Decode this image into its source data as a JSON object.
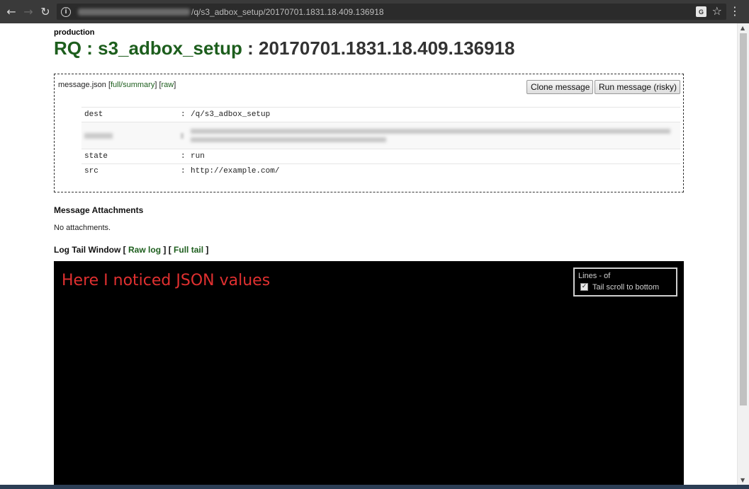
{
  "browser": {
    "url_path": "/q/s3_adbox_setup/20170701.1831.18.409.136918",
    "translate_icon_label": "G",
    "back_glyph": "←",
    "forward_glyph": "→",
    "reload_glyph": "↻",
    "info_glyph": "i",
    "star_glyph": "☆",
    "menu_glyph": "⋮"
  },
  "header": {
    "environment": "production",
    "title_prefix": "RQ",
    "title_sep1": ":",
    "queue_name": "s3_adbox_setup",
    "title_sep2": ":",
    "message_id": "20170701.1831.18.409.136918"
  },
  "message": {
    "filename": "message.json",
    "link_open": "[",
    "full_summary_label": "full/summary",
    "link_mid": "] [",
    "raw_label": "raw",
    "link_close": "]",
    "clone_button": "Clone message",
    "run_button": "Run message (risky)",
    "fields": [
      {
        "key": "dest",
        "sep": ":",
        "value": "/q/s3_adbox_setup"
      },
      {
        "key": "state",
        "sep": ":",
        "value": "run"
      },
      {
        "key": "src",
        "sep": ":",
        "value": "http://example.com/"
      }
    ]
  },
  "attachments": {
    "heading": "Message Attachments",
    "text": "No attachments."
  },
  "log": {
    "heading": "Log Tail Window",
    "open": "[",
    "raw_log_label": "Raw log",
    "mid": "] [",
    "full_tail_label": "Full tail",
    "close": "]",
    "annotation": "Here I noticed JSON values",
    "lines_label": "Lines - of",
    "tail_scroll_label": "Tail scroll to bottom",
    "tail_scroll_checked": true,
    "check_glyph": "✓"
  },
  "colors": {
    "title_green": "#1d5e1d",
    "annotation_red": "#e03030",
    "log_background": "#000000"
  },
  "icons": [
    "back-arrow-icon",
    "forward-arrow-icon",
    "reload-icon",
    "info-icon",
    "translate-icon",
    "star-icon",
    "menu-icon"
  ]
}
